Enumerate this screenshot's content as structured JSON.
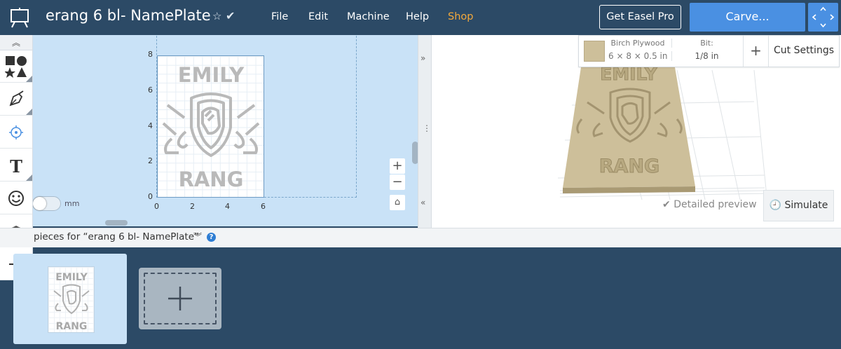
{
  "header": {
    "title": "erang 6 bl- NamePlate",
    "menu": [
      "File",
      "Edit",
      "Machine",
      "Help",
      "Shop"
    ],
    "get_pro_label": "Get Easel Pro",
    "carve_label": "Carve..."
  },
  "canvas": {
    "y_ticks": [
      "8",
      "6",
      "4",
      "2",
      "0"
    ],
    "x_ticks": [
      "0",
      "2",
      "4",
      "6"
    ],
    "unit_label": "mm",
    "design_text_top": "EMILY",
    "design_text_bottom": "RANG"
  },
  "material": {
    "name": "Birch Plywood",
    "dims": "6 × 8 × 0.5 in",
    "bit_label": "Bit:",
    "bit_value": "1/8 in",
    "cut_settings_label": "Cut Settings"
  },
  "preview": {
    "detailed_label": "Detailed preview",
    "simulate_label": "Simulate"
  },
  "workpieces": {
    "header": "pieces for “erang 6 bl- NamePlate”",
    "thumb_top": "EMILY",
    "thumb_bottom": "RANG"
  },
  "colors": {
    "header_bg": "#2c4a66",
    "accent": "#4a90e2",
    "shop": "#f4a93b",
    "canvas_bg": "#c9e2f7",
    "wood": "#cdbf9a"
  }
}
